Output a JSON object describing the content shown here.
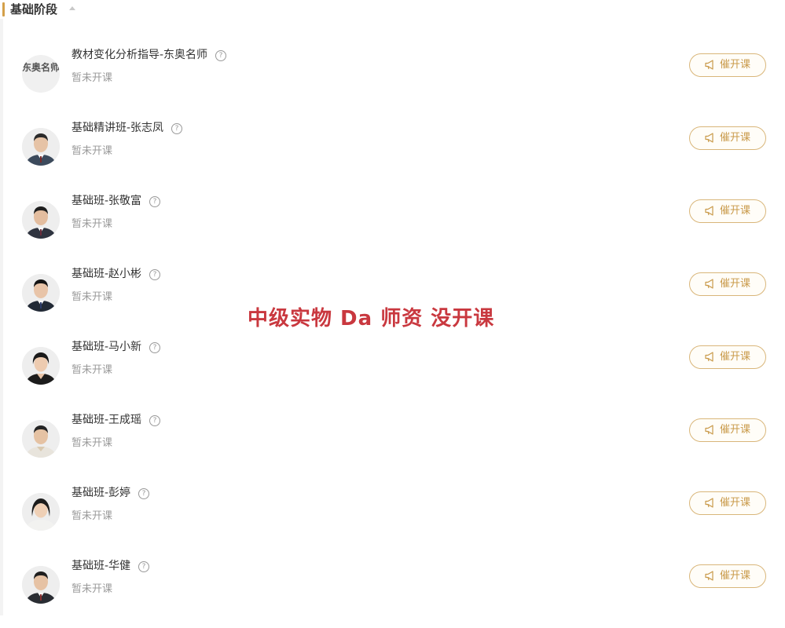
{
  "section": {
    "title": "基础阶段",
    "collapse_icon": "caret-up-icon"
  },
  "courses": [
    {
      "name": "教材变化分析指导-东奥名师",
      "status": "暂未开课",
      "button": "催开课",
      "avatar_type": "logo",
      "logo_text": "东奥名师"
    },
    {
      "name": "基础精讲班-张志凤",
      "status": "暂未开课",
      "button": "催开课",
      "avatar_type": "person"
    },
    {
      "name": "基础班-张敬富",
      "status": "暂未开课",
      "button": "催开课",
      "avatar_type": "person"
    },
    {
      "name": "基础班-赵小彬",
      "status": "暂未开课",
      "button": "催开课",
      "avatar_type": "person"
    },
    {
      "name": "基础班-马小新",
      "status": "暂未开课",
      "button": "催开课",
      "avatar_type": "person"
    },
    {
      "name": "基础班-王成瑶",
      "status": "暂未开课",
      "button": "催开课",
      "avatar_type": "person"
    },
    {
      "name": "基础班-彭婷",
      "status": "暂未开课",
      "button": "催开课",
      "avatar_type": "person"
    },
    {
      "name": "基础班-华健",
      "status": "暂未开课",
      "button": "催开课",
      "avatar_type": "person"
    }
  ],
  "help_icon_glyph": "?",
  "overlay_text": "中级实物 Da  师资 没开课",
  "colors": {
    "accent": "#d4a04a",
    "button_border": "#d9b67a",
    "button_text": "#c99a4a",
    "overlay_text": "#c9383f"
  }
}
